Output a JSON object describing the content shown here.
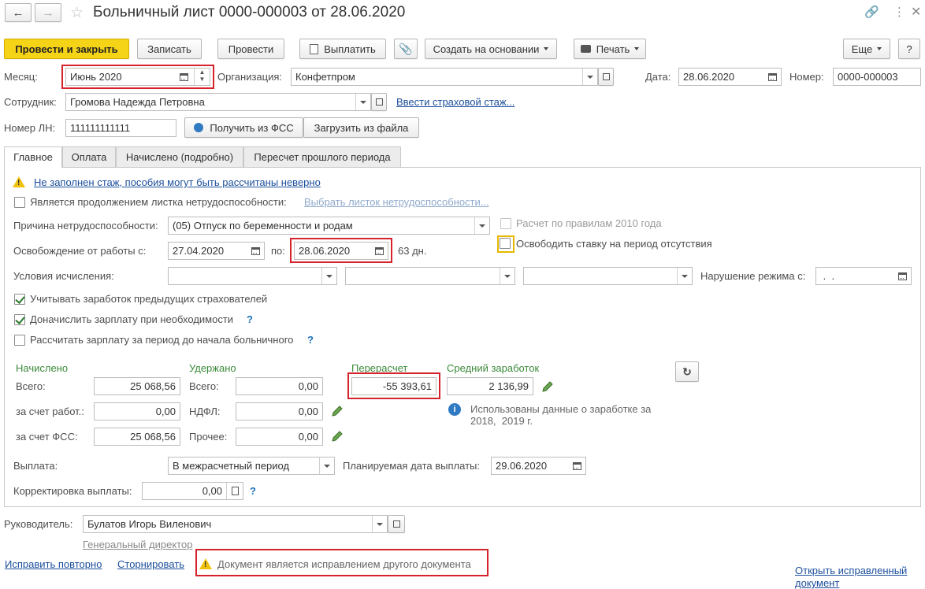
{
  "window": {
    "title": "Больничный лист 0000-000003 от 28.06.2020"
  },
  "toolbar": {
    "post_close": "Провести и закрыть",
    "save": "Записать",
    "post": "Провести",
    "pay": "Выплатить",
    "create_based": "Создать на основании",
    "print": "Печать",
    "more": "Еще",
    "help": "?"
  },
  "header": {
    "month_label": "Месяц:",
    "month_value": "Июнь 2020",
    "org_label": "Организация:",
    "org_value": "Конфетпром",
    "date_label": "Дата:",
    "date_value": "28.06.2020",
    "number_label": "Номер:",
    "number_value": "0000-000003",
    "employee_label": "Сотрудник:",
    "employee_value": "Громова Надежда Петровна",
    "insurance_link": "Ввести страховой стаж...",
    "ln_label": "Номер ЛН:",
    "ln_value": "111111111111",
    "get_fss": "Получить из ФСС",
    "load_file": "Загрузить из файла"
  },
  "tabs": [
    {
      "label": "Главное"
    },
    {
      "label": "Оплата"
    },
    {
      "label": "Начислено (подробно)"
    },
    {
      "label": "Пересчет прошлого периода"
    }
  ],
  "main": {
    "warning_link": "Не заполнен стаж, пособия могут быть рассчитаны неверно",
    "continuation_label": "Является продолжением листка нетрудоспособности:",
    "choose_sheet_link": "Выбрать листок нетрудоспособности...",
    "reason_label": "Причина нетрудоспособности:",
    "reason_value": "(05) Отпуск по беременности и родам",
    "rules2010_label": "Расчет по правилам 2010 года",
    "free_rate_label": "Освободить ставку на период отсутствия",
    "release_label": "Освобождение от работы с:",
    "release_from": "27.04.2020",
    "to_label": "по:",
    "release_to": "28.06.2020",
    "days": "63 дн.",
    "conditions_label": "Условия исчисления:",
    "violation_label": "Нарушение режима с:",
    "violation_value": " .  .",
    "check_prev_employers": "Учитывать заработок предыдущих страхователей",
    "check_additional": "Доначислить зарплату при необходимости",
    "check_before": "Рассчитать зарплату за период до начала больничного",
    "q": "?"
  },
  "totals": {
    "accrued_header": "Начислено",
    "total_label": "Всего:",
    "accrued_total": "25 068,56",
    "employer_label": "за счет работ.:",
    "employer_value": "0,00",
    "fss_label": "за счет ФСС:",
    "fss_value": "25 068,56",
    "withheld_header": "Удержано",
    "withheld_total_label": "Всего:",
    "withheld_total": "0,00",
    "ndfl_label": "НДФЛ:",
    "ndfl_value": "0,00",
    "other_label": "Прочее:",
    "other_value": "0,00",
    "recalc_header": "Перерасчет",
    "recalc_value": "-55 393,61",
    "avg_header": "Средний заработок",
    "avg_value": "2 136,99",
    "earnings_info": "Использованы данные о заработке за",
    "earnings_info2": "2018,  2019 г."
  },
  "payment": {
    "pay_label": "Выплата:",
    "pay_value": "В межрасчетный период",
    "planned_label": "Планируемая дата выплаты:",
    "planned_value": "29.06.2020",
    "adjust_label": "Корректировка выплаты:",
    "adjust_value": "0,00"
  },
  "footer": {
    "manager_label": "Руководитель:",
    "manager_value": "Булатов Игорь Виленович",
    "manager_position": "Генеральный директор",
    "fix_again": "Исправить повторно",
    "reverse": "Сторнировать",
    "correction_note": "Документ является исправлением другого документа",
    "open_fixed_1": "Открыть исправленный",
    "open_fixed_2": "документ"
  },
  "colors": {
    "accent_yellow": "#f5d316",
    "link_blue": "#1c4e9c",
    "highlight_red": "#d5222b",
    "label_green": "#3b8a3b"
  }
}
